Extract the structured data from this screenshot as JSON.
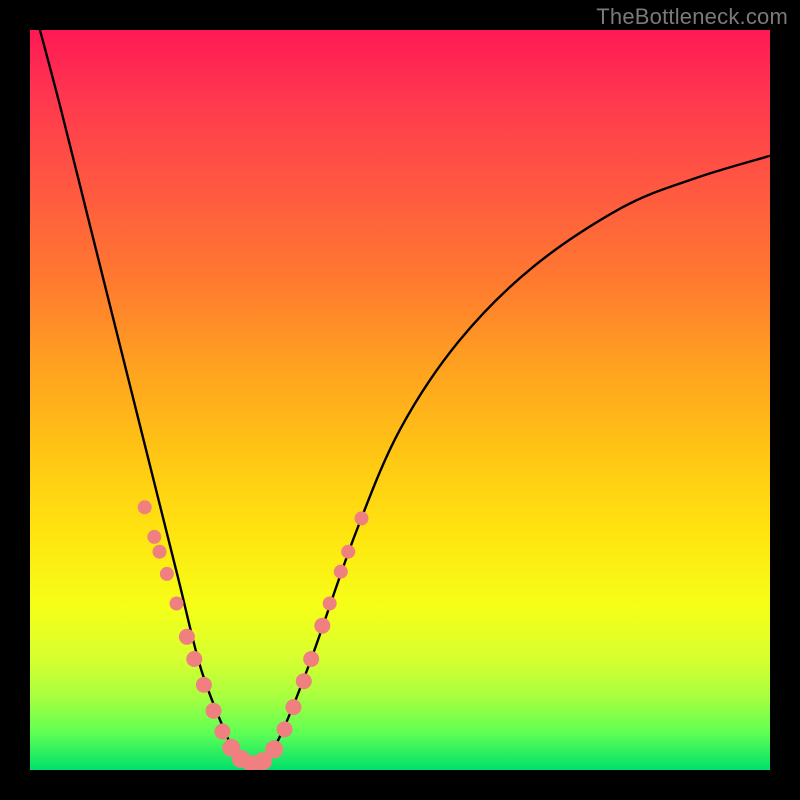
{
  "watermark": {
    "text": "TheBottleneck.com"
  },
  "chart_data": {
    "type": "line",
    "title": "",
    "xlabel": "",
    "ylabel": "",
    "xlim": [
      0,
      1
    ],
    "ylim": [
      0,
      1
    ],
    "series": [
      {
        "name": "bottleneck-curve",
        "x": [
          0.0,
          0.04,
          0.08,
          0.12,
          0.16,
          0.2,
          0.23,
          0.26,
          0.28,
          0.3,
          0.32,
          0.34,
          0.38,
          0.44,
          0.5,
          0.58,
          0.68,
          0.8,
          0.9,
          1.0
        ],
        "values": [
          1.05,
          0.9,
          0.74,
          0.58,
          0.42,
          0.26,
          0.14,
          0.06,
          0.02,
          0.01,
          0.02,
          0.05,
          0.15,
          0.32,
          0.46,
          0.58,
          0.68,
          0.76,
          0.8,
          0.83
        ]
      }
    ],
    "scatter": {
      "name": "highlight-dots",
      "color": "#f08080",
      "radius_main": 9,
      "radius_small": 7,
      "points": [
        {
          "x": 0.155,
          "y": 0.355
        },
        {
          "x": 0.168,
          "y": 0.315
        },
        {
          "x": 0.175,
          "y": 0.295
        },
        {
          "x": 0.185,
          "y": 0.265
        },
        {
          "x": 0.198,
          "y": 0.225
        },
        {
          "x": 0.212,
          "y": 0.18
        },
        {
          "x": 0.222,
          "y": 0.15
        },
        {
          "x": 0.235,
          "y": 0.115
        },
        {
          "x": 0.248,
          "y": 0.08
        },
        {
          "x": 0.26,
          "y": 0.052
        },
        {
          "x": 0.272,
          "y": 0.03
        },
        {
          "x": 0.285,
          "y": 0.015
        },
        {
          "x": 0.3,
          "y": 0.008
        },
        {
          "x": 0.315,
          "y": 0.012
        },
        {
          "x": 0.33,
          "y": 0.028
        },
        {
          "x": 0.344,
          "y": 0.055
        },
        {
          "x": 0.356,
          "y": 0.085
        },
        {
          "x": 0.37,
          "y": 0.12
        },
        {
          "x": 0.38,
          "y": 0.15
        },
        {
          "x": 0.395,
          "y": 0.195
        },
        {
          "x": 0.405,
          "y": 0.225
        },
        {
          "x": 0.42,
          "y": 0.268
        },
        {
          "x": 0.43,
          "y": 0.295
        },
        {
          "x": 0.448,
          "y": 0.34
        }
      ]
    }
  }
}
